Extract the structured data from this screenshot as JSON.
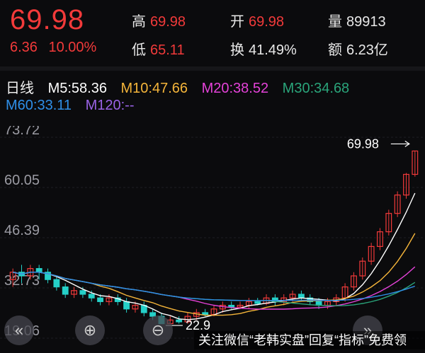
{
  "quote": {
    "price": "69.98",
    "change_abs": "6.36",
    "change_pct": "10.00%",
    "high_label": "高",
    "high": "69.98",
    "low_label": "低",
    "low": "65.11",
    "open_label": "开",
    "open": "69.98",
    "turnover_label": "换",
    "turnover": "41.49%",
    "volume_label": "量",
    "volume": "89913",
    "amount_label": "额",
    "amount": "6.23亿"
  },
  "ma": {
    "period": "日线",
    "m5": "M5:58.36",
    "m10": "M10:47.66",
    "m20": "M20:38.52",
    "m30": "M30:34.68",
    "m60": "M60:33.11",
    "m120": "M120:--"
  },
  "colors": {
    "up": "#f23a3a",
    "down": "#25d0c8",
    "m5": "#ffffff",
    "m10": "#f5b53a",
    "m20": "#e442d8",
    "m30": "#2aa47a",
    "m60": "#2f8fe8",
    "m120": "#9a63e6"
  },
  "chart_data": {
    "type": "candlestick",
    "y_ticks": [
      "73.72",
      "60.05",
      "46.39",
      "32.73",
      "19.06"
    ],
    "ylim": [
      19.06,
      73.72
    ],
    "high_marker": "69.98",
    "low_marker": "22.9",
    "candles": [
      [
        35,
        37,
        33,
        38
      ],
      [
        37,
        36,
        34,
        39
      ],
      [
        36,
        38,
        35,
        39
      ],
      [
        38,
        37,
        35,
        39
      ],
      [
        37,
        35,
        34,
        38
      ],
      [
        35,
        33,
        32,
        36
      ],
      [
        33,
        31,
        30,
        34
      ],
      [
        31,
        32,
        30,
        33
      ],
      [
        32,
        31,
        30,
        33
      ],
      [
        31,
        30,
        29,
        32
      ],
      [
        30,
        29,
        28,
        31
      ],
      [
        29,
        30,
        28,
        31
      ],
      [
        30,
        29,
        28,
        31
      ],
      [
        29,
        27,
        26,
        30
      ],
      [
        27,
        28,
        26,
        29
      ],
      [
        28,
        26,
        25,
        29
      ],
      [
        26,
        25,
        24,
        27
      ],
      [
        25,
        23,
        22.9,
        26
      ],
      [
        23,
        24,
        22.9,
        25
      ],
      [
        24,
        23.5,
        23,
        25
      ],
      [
        23.5,
        25,
        23,
        26
      ],
      [
        25,
        26,
        24,
        27
      ],
      [
        26,
        25.5,
        25,
        27
      ],
      [
        25.5,
        27,
        25,
        28
      ],
      [
        27,
        28,
        26,
        29
      ],
      [
        28,
        27.5,
        27,
        29
      ],
      [
        27.5,
        28,
        27,
        29
      ],
      [
        28,
        29,
        27,
        30
      ],
      [
        29,
        28.5,
        28,
        30
      ],
      [
        28.5,
        30,
        28,
        31
      ],
      [
        30,
        29,
        28,
        31
      ],
      [
        29,
        30,
        28,
        31
      ],
      [
        30,
        31,
        29,
        32
      ],
      [
        31,
        30,
        29,
        32
      ],
      [
        30,
        29,
        28,
        31
      ],
      [
        29,
        28,
        27,
        30
      ],
      [
        28,
        29,
        27,
        30
      ],
      [
        29,
        30,
        28,
        31
      ],
      [
        30,
        33,
        29,
        34
      ],
      [
        33,
        36,
        32,
        37
      ],
      [
        36,
        40,
        35,
        41
      ],
      [
        40,
        44,
        39,
        45
      ],
      [
        44,
        48,
        43,
        49
      ],
      [
        48,
        53,
        47,
        54
      ],
      [
        53,
        58,
        52,
        59
      ],
      [
        58,
        63.62,
        57,
        64
      ],
      [
        63.62,
        69.98,
        63,
        69.98
      ]
    ]
  },
  "controls": {
    "prev_icon": "«",
    "zoom_in_icon": "⊕",
    "zoom_out_icon": "⊖",
    "next_icon": "»"
  },
  "watermark": "关注微信“老韩实盘”回复“指标”免费领"
}
